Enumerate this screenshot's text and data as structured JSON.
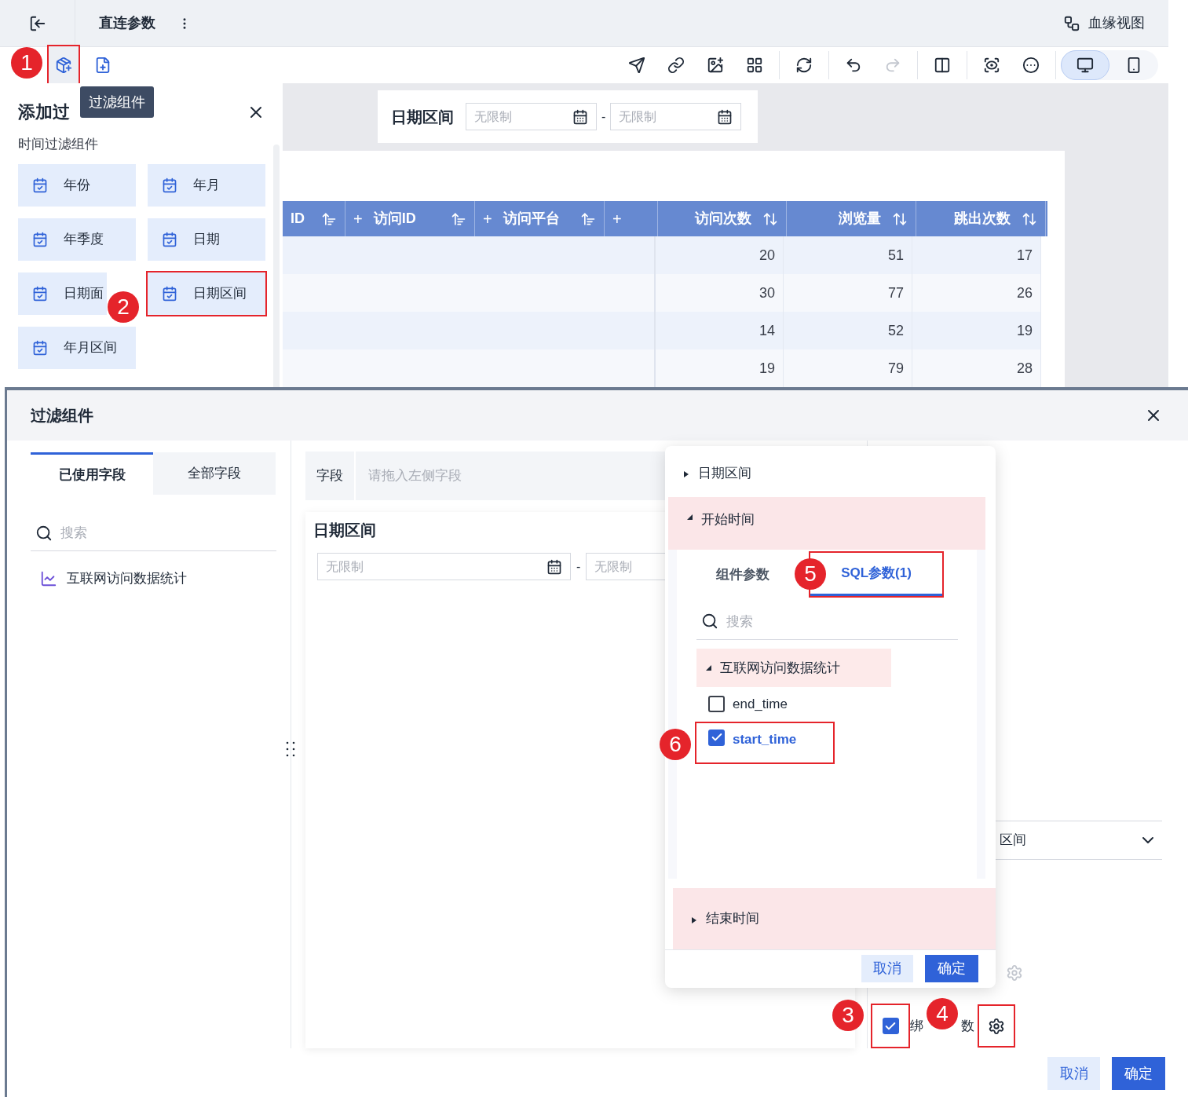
{
  "header": {
    "title": "直连参数",
    "lineage_label": "血缘视图"
  },
  "left_tools": [
    {
      "kind": "filter",
      "highlighted": true
    },
    {
      "kind": "form",
      "highlighted": false
    }
  ],
  "tooltip": "过滤组件",
  "device_modes": [
    {
      "kind": "desktop",
      "selected": true
    },
    {
      "kind": "mobile",
      "selected": false
    }
  ],
  "add_panel": {
    "title": "添加过",
    "section": "时间过滤组件",
    "items": [
      {
        "label": "年份",
        "highlighted": false
      },
      {
        "label": "年月",
        "highlighted": false
      },
      {
        "label": "年季度",
        "highlighted": false
      },
      {
        "label": "日期",
        "highlighted": false
      },
      {
        "label": "日期面",
        "highlighted": false
      },
      {
        "label": "日期区间",
        "highlighted": true
      },
      {
        "label": "年月区间",
        "highlighted": false
      }
    ]
  },
  "filter_card": {
    "title": "日期区间",
    "start_placeholder": "无限制",
    "separator": "-",
    "end_placeholder": "无限制"
  },
  "table": {
    "columns": [
      {
        "label": "ID",
        "kind": "dimension"
      },
      {
        "prefix": "+",
        "label": "访问ID",
        "kind": "dimension"
      },
      {
        "prefix": "+",
        "label": "访问平台",
        "kind": "dimension"
      },
      {
        "prefix": "+",
        "kind": "dimension"
      },
      {
        "label": "访问次数",
        "kind": "measure"
      },
      {
        "label": "浏览量",
        "kind": "measure"
      },
      {
        "label": "跳出次数",
        "kind": "measure"
      }
    ],
    "rows": [
      {
        "cells": [
          "20",
          "51",
          "17"
        ]
      },
      {
        "cells": [
          "30",
          "77",
          "26"
        ]
      },
      {
        "cells": [
          "14",
          "52",
          "19"
        ]
      },
      {
        "cells": [
          "19",
          "79",
          "28"
        ]
      }
    ]
  },
  "dialog": {
    "title": "过滤组件",
    "field_tabs": [
      {
        "label": "已使用字段",
        "selected": true
      },
      {
        "label": "全部字段",
        "selected": false
      }
    ],
    "search_placeholder": "搜索",
    "datasets": [
      {
        "label": "互联网访问数据统计"
      }
    ],
    "field_label": "字段",
    "field_placeholder": "请拖入左侧字段",
    "preview": {
      "title": "日期区间",
      "start_placeholder": "无限制",
      "separator": "-",
      "end_placeholder": "无限制"
    },
    "select_value": "区间",
    "bind": {
      "checked": true,
      "label_start": "绑",
      "label_end": "数",
      "highlighted": true
    },
    "cancel": "取消",
    "ok": "确定"
  },
  "popover": {
    "sections": [
      {
        "label": "日期区间",
        "expanded": false,
        "highlighted": false
      },
      {
        "label": "开始时间",
        "expanded": true,
        "highlighted": true
      },
      {
        "label": "结束时间",
        "expanded": false,
        "highlighted": true
      }
    ],
    "tabs": [
      {
        "label": "组件参数",
        "selected": false,
        "highlighted": false
      },
      {
        "label": "SQL参数(1)",
        "selected": true,
        "highlighted": true
      }
    ],
    "search_placeholder": "搜索",
    "tree": {
      "label": "互联网访问数据统计",
      "expanded": true,
      "children": [
        {
          "label": "end_time",
          "checked": false,
          "highlighted": false
        },
        {
          "label": "start_time",
          "checked": true,
          "highlighted": true
        }
      ]
    },
    "cancel": "取消",
    "ok": "确定"
  },
  "markers": [
    {
      "label": "1"
    },
    {
      "label": "2"
    },
    {
      "label": "3"
    },
    {
      "label": "4"
    },
    {
      "label": "5"
    },
    {
      "label": "6"
    }
  ]
}
